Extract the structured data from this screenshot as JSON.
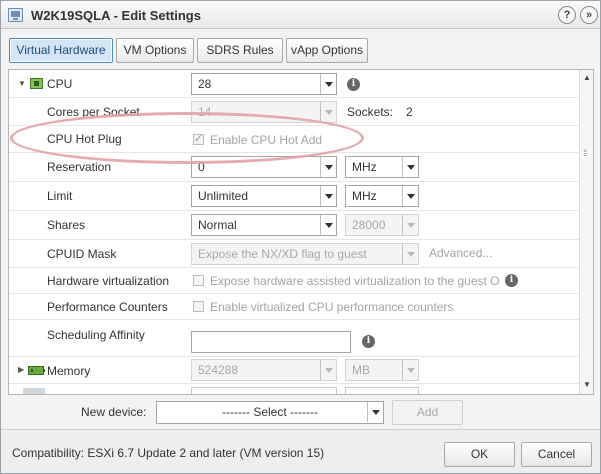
{
  "window": {
    "title": "W2K19SQLA - Edit Settings",
    "help_label": "?",
    "more_label": "»"
  },
  "tabs": [
    {
      "label": "Virtual Hardware",
      "active": true
    },
    {
      "label": "VM Options",
      "active": false
    },
    {
      "label": "SDRS Rules",
      "active": false
    },
    {
      "label": "vApp Options",
      "active": false
    }
  ],
  "cpu": {
    "label": "CPU",
    "value": "28",
    "info_icon": "info-icon",
    "cores_per_socket": {
      "label": "Cores per Socket",
      "value": "14"
    },
    "sockets": {
      "label": "Sockets:",
      "value": "2"
    },
    "hot_plug": {
      "label": "CPU Hot Plug",
      "checkbox_label": "Enable CPU Hot Add",
      "checked": true
    },
    "reservation": {
      "label": "Reservation",
      "value": "0",
      "unit": "MHz"
    },
    "limit": {
      "label": "Limit",
      "value": "Unlimited",
      "unit": "MHz"
    },
    "shares": {
      "label": "Shares",
      "value": "Normal",
      "amount": "28000"
    },
    "cpuid_mask": {
      "label": "CPUID Mask",
      "value": "Expose the NX/XD flag to guest",
      "advanced_label": "Advanced..."
    },
    "hw_virtualization": {
      "label": "Hardware virtualization",
      "checkbox_label": "Expose hardware assisted virtualization to the guest O",
      "checked": false
    },
    "perf_counters": {
      "label": "Performance Counters",
      "checkbox_label": "Enable virtualized CPU performance counters",
      "checked": false
    },
    "scheduling_affinity": {
      "label": "Scheduling Affinity",
      "value": ""
    }
  },
  "memory": {
    "label": "Memory",
    "value": "524288",
    "unit": "MB"
  },
  "new_device": {
    "label": "New device:",
    "select_value": "------- Select -------",
    "add_label": "Add"
  },
  "footer": {
    "compatibility": "Compatibility: ESXi 6.7 Update 2 and later (VM version 15)",
    "ok_label": "OK",
    "cancel_label": "Cancel"
  },
  "colors": {
    "active_tab_bg": "#d4e6f6",
    "annotation": "#e4a1a8",
    "accent": "#4a8ec7"
  }
}
